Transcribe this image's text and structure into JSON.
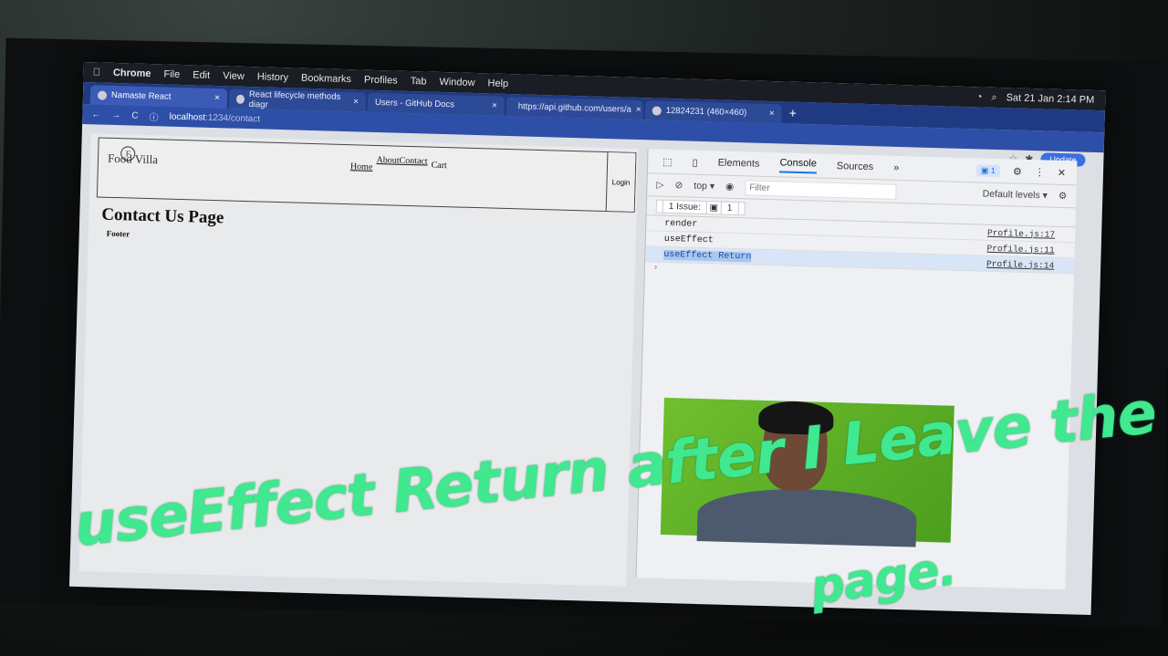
{
  "menubar": {
    "app": "Chrome",
    "items": [
      "File",
      "Edit",
      "View",
      "History",
      "Bookmarks",
      "Profiles",
      "Tab",
      "Window",
      "Help"
    ],
    "clock": "Sat 21 Jan  2:14 PM"
  },
  "tabs": [
    {
      "label": "Namaste React",
      "active": true
    },
    {
      "label": "React lifecycle methods diagr",
      "active": false
    },
    {
      "label": "Users - GitHub Docs",
      "active": false
    },
    {
      "label": "https://api.github.com/users/a",
      "active": false
    },
    {
      "label": "12824231 (460×460)",
      "active": false
    }
  ],
  "address": {
    "host": "localhost",
    "path": ":1234/contact"
  },
  "update_label": "Update",
  "site": {
    "logo": "Food Villa",
    "logo_letter": "F",
    "nav": [
      "Home",
      "About",
      "Contact"
    ],
    "cart": "Cart",
    "login": "Login",
    "title": "Contact Us Page",
    "footer": "Footer"
  },
  "devtools": {
    "tabs": [
      "Elements",
      "Console",
      "Sources"
    ],
    "active_tab": "Console",
    "more": "»",
    "issue_badge": "1",
    "context": "top ▾",
    "filter_placeholder": "Filter",
    "levels": "Default levels ▾",
    "issues_label": "1 Issue:",
    "issues_count": "1",
    "logs": [
      {
        "msg": "render",
        "src": "Profile.js:17",
        "selected": false
      },
      {
        "msg": "useEffect",
        "src": "Profile.js:11",
        "selected": false
      },
      {
        "msg": "useEffect Return",
        "src": "Profile.js:14",
        "selected": true
      }
    ]
  },
  "annotation": {
    "line1": "useEffect Return after I Leave the",
    "line2": "page."
  }
}
